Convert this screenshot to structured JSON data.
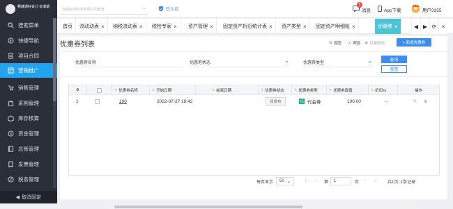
{
  "brand": {
    "name": "畅捷通好会计 标准版",
    "sub": "标准版"
  },
  "sidebar": {
    "items": [
      {
        "label": "搜索菜单",
        "icon": "search-icon"
      },
      {
        "label": "快捷导航",
        "icon": "compass-icon"
      },
      {
        "label": "项目合同",
        "icon": "document-icon"
      },
      {
        "label": "营销推广",
        "icon": "grid-icon",
        "active": true
      },
      {
        "label": "销售管理",
        "icon": "cart-icon"
      },
      {
        "label": "采购管理",
        "icon": "bag-icon"
      },
      {
        "label": "库存核算",
        "icon": "box-icon"
      },
      {
        "label": "资金管理",
        "icon": "money-icon"
      },
      {
        "label": "总账管理",
        "icon": "ledger-icon"
      },
      {
        "label": "发票管理",
        "icon": "invoice-icon"
      },
      {
        "label": "税务管理",
        "icon": "tax-icon"
      }
    ],
    "collapse_label": "取消固定"
  },
  "topbar": {
    "company_placeholder": "智能会计科技有限公司账套",
    "verified_label": "已认证",
    "messages_label": "消息",
    "messages_badge": "5",
    "app_label": "App下载",
    "user_label": "用户3355"
  },
  "tabs": {
    "items": [
      {
        "label": "首页",
        "closable": false
      },
      {
        "label": "流动动表",
        "closable": true
      },
      {
        "label": "纳税流动表",
        "closable": true
      },
      {
        "label": "税检专家",
        "closable": true
      },
      {
        "label": "资产管理",
        "closable": true
      },
      {
        "label": "固定资产折旧统计表",
        "closable": true
      },
      {
        "label": "资产类型",
        "closable": true
      },
      {
        "label": "固定资产明细账",
        "closable": true
      },
      {
        "label": "优惠券",
        "closable": true,
        "active": true
      }
    ]
  },
  "page": {
    "title": "优惠券列表",
    "tools": {
      "view": "视图",
      "help": "帮助",
      "batch_delete": "批量删除",
      "new_coupon": "+ 新增优惠券"
    }
  },
  "filters": {
    "name_label": "优惠券名称",
    "status_label": "优惠券状态",
    "type_label": "优惠券类型",
    "query_label": "查询",
    "reset_label": "重置"
  },
  "grid": {
    "columns": [
      "优惠券名称",
      "开始日期",
      "结束日期",
      "优惠券状态",
      "优惠券类型",
      "优惠券面值",
      "折扣%",
      "操作"
    ],
    "rows": [
      {
        "index": "1",
        "name": "100",
        "start_date": "2022-07-27 19:42",
        "end_date": "",
        "status": "待发布",
        "type_badge": "代",
        "type": "代金券",
        "face_value": "100.00",
        "discount": "--"
      }
    ]
  },
  "pager": {
    "per_page_label": "每页显示",
    "per_page_value": "50",
    "page_prefix": "第",
    "page_value": "1",
    "page_suffix": "页",
    "summary": "共1页, 1条记录"
  }
}
